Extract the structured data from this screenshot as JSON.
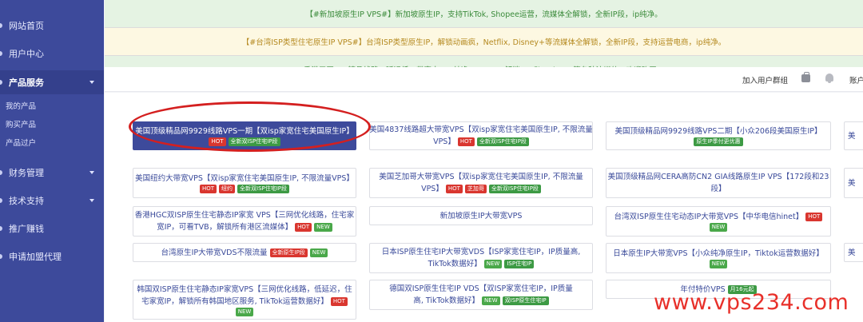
{
  "sidebar": {
    "items": [
      {
        "label": "网站首页"
      },
      {
        "label": "用户中心"
      },
      {
        "label": "产品服务"
      },
      {
        "label": "财务管理"
      },
      {
        "label": "技术支持"
      },
      {
        "label": "推广赚钱"
      },
      {
        "label": "申请加盟代理"
      }
    ],
    "subitems": [
      {
        "label": "我的产品"
      },
      {
        "label": "购买产品"
      },
      {
        "label": "产品过户"
      }
    ]
  },
  "notices": [
    {
      "text": "【#新加坡原生IP VPS#】新加坡原生IP，支持TikTok, Shopee运营，流媒体全解锁，全新IP段，ip纯净。"
    },
    {
      "text": "【#台湾ISP类型住宅原生IP VPS#】台湾ISP类型原生IP，解锁动画疯，Netflix, Disney+等流媒体全解锁，全新IP段，支持运营电商，ip纯净。"
    },
    {
      "text": "香港三网CMI精品线路，延迟低，带宽大，IP纯净，ISP IP，解锁Netflix/Disney等各种流媒体，欢迎购买。"
    }
  ],
  "topbar": {
    "join_group": "加入用户群组",
    "account": "账户"
  },
  "products": {
    "c1": {
      "title": "美国顶级精品网9929线路VPS一期【双isp家宽住宅美国原生IP】",
      "badges": [
        "HOT",
        "全新双ISP住宅IP段"
      ]
    },
    "c2": {
      "title1": "美国4837线路超大带宽VPS【双isp家宽住宅美国原生IP, 不限流量",
      "title2": "VPS】",
      "badges": [
        "HOT",
        "全新双ISP住宅IP段"
      ]
    },
    "c3": {
      "title": "美国顶级精品网9929线路VPS二期【小众206段美国原生IP】",
      "badges": [
        "原生IP季付更优惠"
      ]
    },
    "c4": {
      "title": "美国纽约大带宽VPS【双isp家宽住宅美国原生IP, 不限流量VPS】",
      "badges": [
        "HOT",
        "纽约",
        "全新双ISP住宅IP段"
      ]
    },
    "c5": {
      "title1": "美国芝加哥大带宽VPS【双isp家宽住宅美国原生IP, 不限流量",
      "title2": "VPS】",
      "badges": [
        "HOT",
        "芝加哥",
        "全新双ISP住宅IP段"
      ]
    },
    "c6": {
      "title1": "美国顶级精品网CERA高防CN2 GIA线路原生IP VPS【172段和23",
      "title2": "段】"
    },
    "c7": {
      "title1": "香港HGC双ISP原生住宅静态IP家宽 VPS【三网优化线路，住宅家",
      "title2": "宽IP，可看TVB，解锁所有港区流媒体】",
      "badges": [
        "HOT",
        "NEW"
      ]
    },
    "c8": {
      "title": "新加坡原生IP大带宽VPS"
    },
    "c9": {
      "title": "台湾双ISP原生住宅动态IP大带宽VPS【中华电信hinet】",
      "badges": [
        "HOT",
        "NEW"
      ]
    },
    "c10": {
      "title": "台湾原生IP大带宽VDS不限流量",
      "badges": [
        "全新原生IP段",
        "NEW"
      ]
    },
    "c11": {
      "title1": "日本ISP原生住宅IP大带宽VDS【ISP家宽住宅IP，IP质量高,",
      "title2": "TikTok数据好】",
      "badges": [
        "NEW",
        "ISP住宅IP"
      ]
    },
    "c12": {
      "title": "日本原生IP大带宽VPS【小众纯净原生IP，Tiktok运营数据好】",
      "badges": [
        "NEW"
      ]
    },
    "c13": {
      "title1": "韩国双ISP原生住宅静态IP家宽VPS【三网优化线路，低延迟，住",
      "title2": "宅家宽IP，解锁所有韩国地区服务, TikTok运营数据好】",
      "badges": [
        "HOT",
        "NEW"
      ]
    },
    "c14": {
      "title1": "德国双ISP原生住宅IP VDS【双ISP家宽住宅IP，IP质量",
      "title2": "高, TikTok数据好】",
      "badges": [
        "NEW",
        "双ISP原生住宅IP"
      ]
    },
    "c15": {
      "title": "年付特价VPS",
      "badges": [
        "月16元起"
      ]
    },
    "edge": {
      "t1": "美",
      "t2": "美",
      "t3": "美"
    }
  },
  "watermark": "www.vps234.com"
}
